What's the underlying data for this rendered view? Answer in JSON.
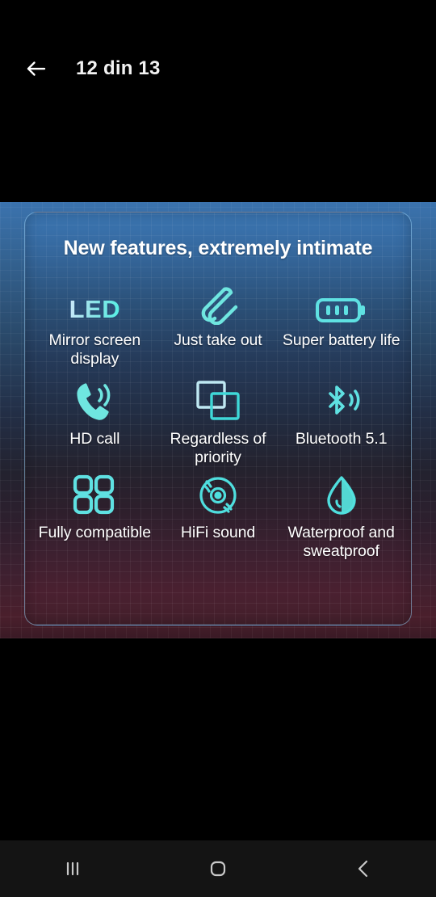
{
  "header": {
    "back_icon": "arrow-left-icon",
    "title": "12 din 13"
  },
  "promo_card": {
    "title": "New features, extremely intimate",
    "accent_color": "#4fe3dd",
    "border_color": "#96c8eb",
    "features": [
      {
        "icon": "led-text-icon",
        "icon_text": "LED",
        "label": "Mirror screen display"
      },
      {
        "icon": "paperclip-icon",
        "icon_text": "",
        "label": "Just take out"
      },
      {
        "icon": "battery-full-icon",
        "icon_text": "",
        "label": "Super battery life"
      },
      {
        "icon": "phone-call-waves-icon",
        "icon_text": "",
        "label": "HD call"
      },
      {
        "icon": "overlapping-squares-icon",
        "icon_text": "",
        "label": "Regardless of priority"
      },
      {
        "icon": "bluetooth-waves-icon",
        "icon_text": "",
        "label": "Bluetooth 5.1"
      },
      {
        "icon": "four-squares-grid-icon",
        "icon_text": "",
        "label": "Fully compatible"
      },
      {
        "icon": "vinyl-disc-icon",
        "icon_text": "",
        "label": "HiFi sound"
      },
      {
        "icon": "water-droplet-icon",
        "icon_text": "",
        "label": "Waterproof and sweatproof"
      }
    ]
  },
  "navbar": {
    "recents_icon": "recents-icon",
    "home_icon": "home-icon",
    "back_icon": "back-chevron-icon"
  }
}
